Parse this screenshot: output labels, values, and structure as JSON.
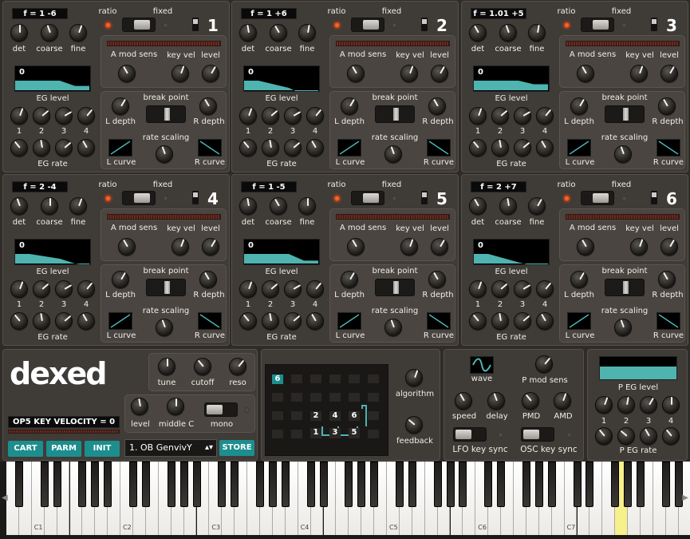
{
  "colors": {
    "accent": "#1d8e8e",
    "eg_fill": "#4fb3b0",
    "led_on": "#ff4a10",
    "key_highlight": "#f6f18a"
  },
  "operator_labels": {
    "ratio": "ratio",
    "fixed": "fixed",
    "det": "det",
    "coarse": "coarse",
    "fine": "fine",
    "a_mod_sens": "A mod sens",
    "key_vel": "key vel",
    "level": "level",
    "eg_level": "EG level",
    "eg_rate": "EG rate",
    "break_point": "break point",
    "l_depth": "L depth",
    "r_depth": "R depth",
    "rate_scaling": "rate scaling",
    "l_curve": "L curve",
    "r_curve": "R curve",
    "eg_nums": [
      "1",
      "2",
      "3",
      "4"
    ],
    "eg_level_value": "0"
  },
  "operators": [
    {
      "num": "1",
      "freq": "f = 1 -6",
      "eg": [
        1.0,
        1.0,
        0.78,
        0.78
      ]
    },
    {
      "num": "2",
      "freq": "f = 1 +6",
      "eg": [
        1.0,
        0.7,
        0.4,
        0.15
      ]
    },
    {
      "num": "3",
      "freq": "f = 1.01 +5",
      "eg": [
        1.0,
        1.0,
        0.85,
        0.85
      ]
    },
    {
      "num": "4",
      "freq": "f = 2 -4",
      "eg": [
        1.0,
        0.8,
        0.6,
        0.5
      ]
    },
    {
      "num": "5",
      "freq": "f = 1 -5",
      "eg": [
        1.0,
        1.0,
        0.72,
        0.72
      ]
    },
    {
      "num": "6",
      "freq": "f = 2 +7",
      "eg": [
        1.0,
        0.65,
        0.5,
        0.45
      ]
    }
  ],
  "global": {
    "logo": "dexed",
    "tune": "tune",
    "cutoff": "cutoff",
    "reso": "reso",
    "level": "level",
    "middle_c": "middle C",
    "mono": "mono",
    "status": "OP5 KEY VELOCITY = 0",
    "cart_button": "CART",
    "parm_button": "PARM",
    "init_button": "INIT",
    "program": "1. OB GenvivY",
    "store_button": "STORE"
  },
  "algorithm": {
    "label": "algorithm",
    "feedback": "feedback",
    "top_op": "6",
    "ops": [
      "2",
      "4",
      "6",
      "1",
      "3",
      "5"
    ]
  },
  "lfo": {
    "wave": "wave",
    "p_mod_sens": "P mod sens",
    "speed": "speed",
    "delay": "delay",
    "pmd": "PMD",
    "amd": "AMD",
    "lfo_key_sync": "LFO key sync",
    "osc_key_sync": "OSC key sync"
  },
  "pitch_eg": {
    "p_eg_level": "P EG level",
    "p_eg_rate": "P EG rate",
    "nums": [
      "1",
      "2",
      "3",
      "4"
    ]
  },
  "keyboard": {
    "octaves": [
      "C1",
      "C2",
      "C3",
      "C4",
      "C5",
      "C6",
      "C7"
    ]
  }
}
